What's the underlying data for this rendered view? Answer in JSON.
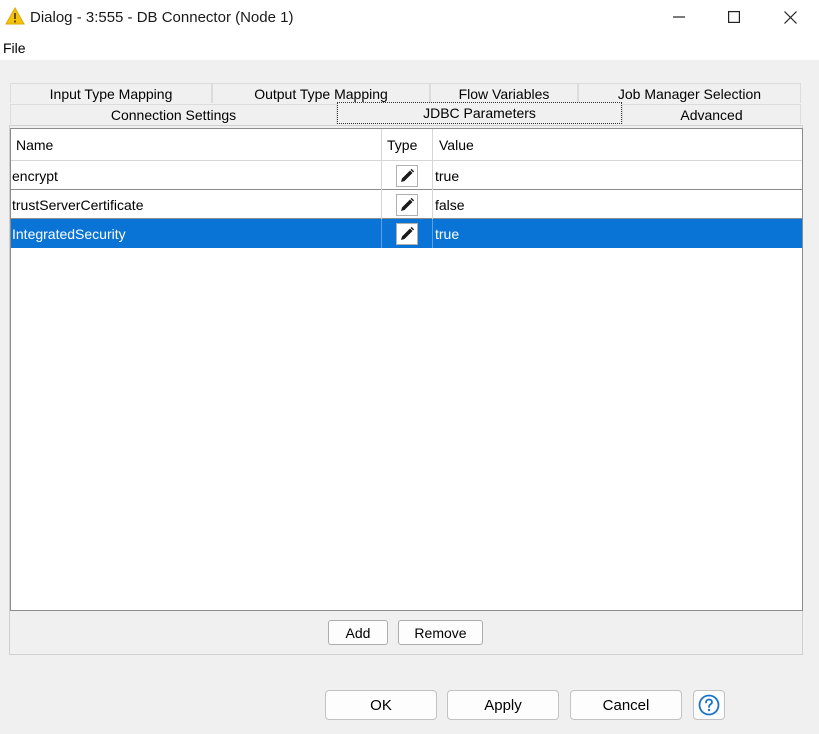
{
  "window": {
    "title": "Dialog - 3:555 - DB Connector (Node 1)",
    "icon": "warning-triangle-icon",
    "accent": "#f4c20d"
  },
  "menu": {
    "file_label": "File"
  },
  "tabs_row1": [
    {
      "label": "Input Type Mapping"
    },
    {
      "label": "Output Type Mapping"
    },
    {
      "label": "Flow Variables"
    },
    {
      "label": "Job Manager Selection"
    }
  ],
  "tabs_row2": [
    {
      "label": "Connection Settings"
    },
    {
      "label": "JDBC Parameters",
      "active": true
    },
    {
      "label": "Advanced"
    }
  ],
  "table": {
    "columns": {
      "name": "Name",
      "type": "Type",
      "value": "Value"
    },
    "rows": [
      {
        "name": "encrypt",
        "type_icon": "pencil-icon",
        "value": "true"
      },
      {
        "name": "trustServerCertificate",
        "type_icon": "pencil-icon",
        "value": "false"
      },
      {
        "name": "IntegratedSecurity",
        "type_icon": "pencil-icon",
        "value": "true",
        "selected": true
      }
    ],
    "selection_color": "#0a74d6"
  },
  "actions": {
    "add_label": "Add",
    "remove_label": "Remove"
  },
  "footer": {
    "ok_label": "OK",
    "apply_label": "Apply",
    "cancel_label": "Cancel",
    "help_icon": "help-icon",
    "help_color": "#1a73c9"
  }
}
